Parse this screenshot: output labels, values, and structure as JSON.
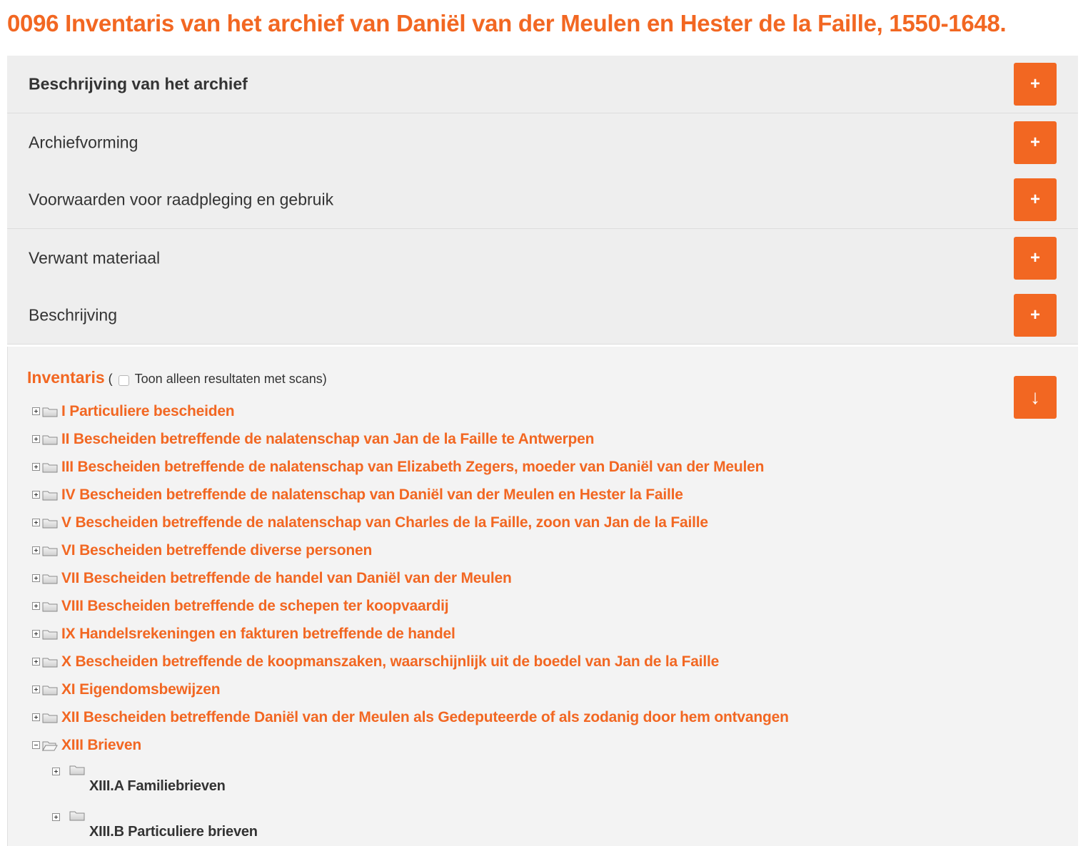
{
  "page": {
    "title": "0096 Inventaris van het archief van Daniël van der Meulen en Hester de la Faille, 1550-1648."
  },
  "accordion": {
    "items": [
      {
        "label": "Beschrijving van het archief",
        "button": "+"
      },
      {
        "label": "Archiefvorming",
        "button": "+"
      },
      {
        "label": "Voorwaarden voor raadpleging en gebruik",
        "button": "+"
      },
      {
        "label": "Verwant materiaal",
        "button": "+"
      },
      {
        "label": "Beschrijving",
        "button": "+"
      }
    ]
  },
  "inventaris": {
    "title": "Inventaris",
    "open_paren": "(",
    "scan_filter_label": "Toon alleen resultaten met scans)",
    "scan_filter_checked": false,
    "download_icon": "↓",
    "tree": [
      {
        "label": "I Particuliere bescheiden",
        "expanded": false
      },
      {
        "label": "II Bescheiden betreffende de nalatenschap van Jan de la Faille te Antwerpen",
        "expanded": false
      },
      {
        "label": "III Bescheiden betreffende de nalatenschap van Elizabeth Zegers, moeder van Daniël van der Meulen",
        "expanded": false
      },
      {
        "label": "IV Bescheiden betreffende de nalatenschap van Daniël van der Meulen en Hester la Faille",
        "expanded": false
      },
      {
        "label": "V Bescheiden betreffende de nalatenschap van Charles de la Faille, zoon van Jan de la Faille",
        "expanded": false
      },
      {
        "label": "VI Bescheiden betreffende diverse personen",
        "expanded": false
      },
      {
        "label": "VII Bescheiden betreffende de handel van Daniël van der Meulen",
        "expanded": false
      },
      {
        "label": "VIII Bescheiden betreffende de schepen ter koopvaardij",
        "expanded": false
      },
      {
        "label": "IX Handelsrekeningen en fakturen betreffende de handel",
        "expanded": false
      },
      {
        "label": "X Bescheiden betreffende de koopmanszaken, waarschijnlijk uit de boedel van Jan de la Faille",
        "expanded": false
      },
      {
        "label": "XI Eigendomsbewijzen",
        "expanded": false
      },
      {
        "label": "XII Bescheiden betreffende Daniël van der Meulen als Gedeputeerde of als zodanig door hem ontvangen",
        "expanded": false
      },
      {
        "label": "XIII Brieven",
        "expanded": true
      }
    ],
    "subtree": [
      {
        "label": "XIII.A Familiebrieven",
        "expanded": false
      },
      {
        "label": "XIII.B Particuliere brieven",
        "expanded": false
      }
    ]
  },
  "colors": {
    "accent": "#f26722",
    "panel_bg": "#eeeeee",
    "text": "#333333"
  },
  "icons": {
    "expand_toggle": "plus-box-icon",
    "collapse_toggle": "minus-box-icon",
    "folder_closed": "folder-icon",
    "folder_open": "folder-open-icon",
    "accordion_expand": "plus-icon",
    "download": "arrow-down-icon"
  }
}
